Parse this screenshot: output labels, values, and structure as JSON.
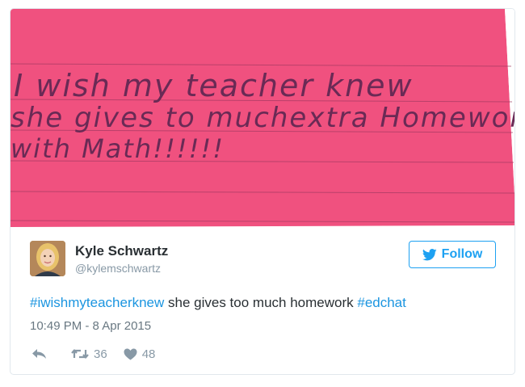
{
  "image": {
    "handwriting_lines": [
      "I wish my teacher knew",
      "she gives to muchextra Homework",
      "with Math!!!!!!"
    ],
    "paper_color": "#f0517f"
  },
  "author": {
    "display_name": "Kyle Schwartz",
    "handle": "@kylemschwartz"
  },
  "follow_button": {
    "label": "Follow",
    "color": "#1da1f2"
  },
  "tweet": {
    "hashtag_1": "#iwishmyteacherknew",
    "text_middle": " she gives too much homework ",
    "hashtag_2": "#edchat",
    "timestamp": "10:49 PM - 8 Apr 2015"
  },
  "actions": {
    "reply_icon": "reply-icon",
    "retweet_icon": "retweet-icon",
    "retweet_count": "36",
    "like_icon": "heart-icon",
    "like_count": "48"
  }
}
